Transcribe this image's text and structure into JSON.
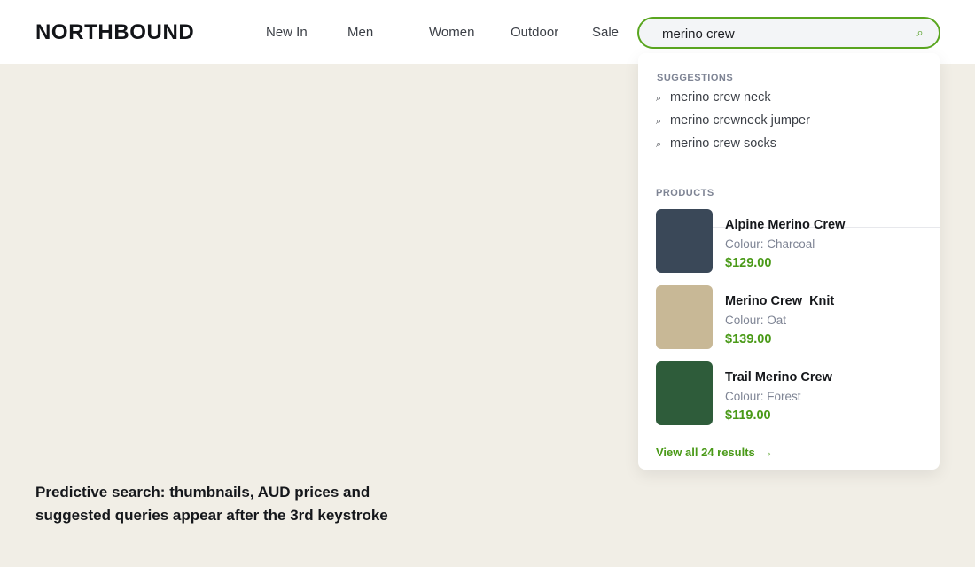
{
  "brand": "NORTHBOUND",
  "nav": [
    "New In",
    "Men",
    "Women",
    "Outdoor",
    "Sale"
  ],
  "search": {
    "value": "merino crew",
    "icon": "search-icon"
  },
  "dropdown": {
    "suggestions_title": "SUGGESTIONS",
    "suggestions": [
      "merino crew neck",
      "merino crewneck jumper",
      "merino crew socks"
    ],
    "products_title": "PRODUCTS",
    "products": [
      {
        "name": "Alpine Merino Crew",
        "colour": "Colour: Charcoal",
        "price": "$129.00",
        "swatch": "#3a4858"
      },
      {
        "name": "Merino Crew  Knit",
        "colour": "Colour: Oat",
        "price": "$139.00",
        "swatch": "#c8b896"
      },
      {
        "name": "Trail Merino Crew",
        "colour": "Colour: Forest",
        "price": "$119.00",
        "swatch": "#2e5c3a"
      }
    ],
    "view_all": "View all 24 results",
    "view_all_arrow": "→"
  },
  "caption": "Predictive search: thumbnails, AUD prices and suggested queries appear after the 3rd keystroke",
  "colors": {
    "accent": "#4a9a18",
    "page_bg": "#f1eee6"
  }
}
